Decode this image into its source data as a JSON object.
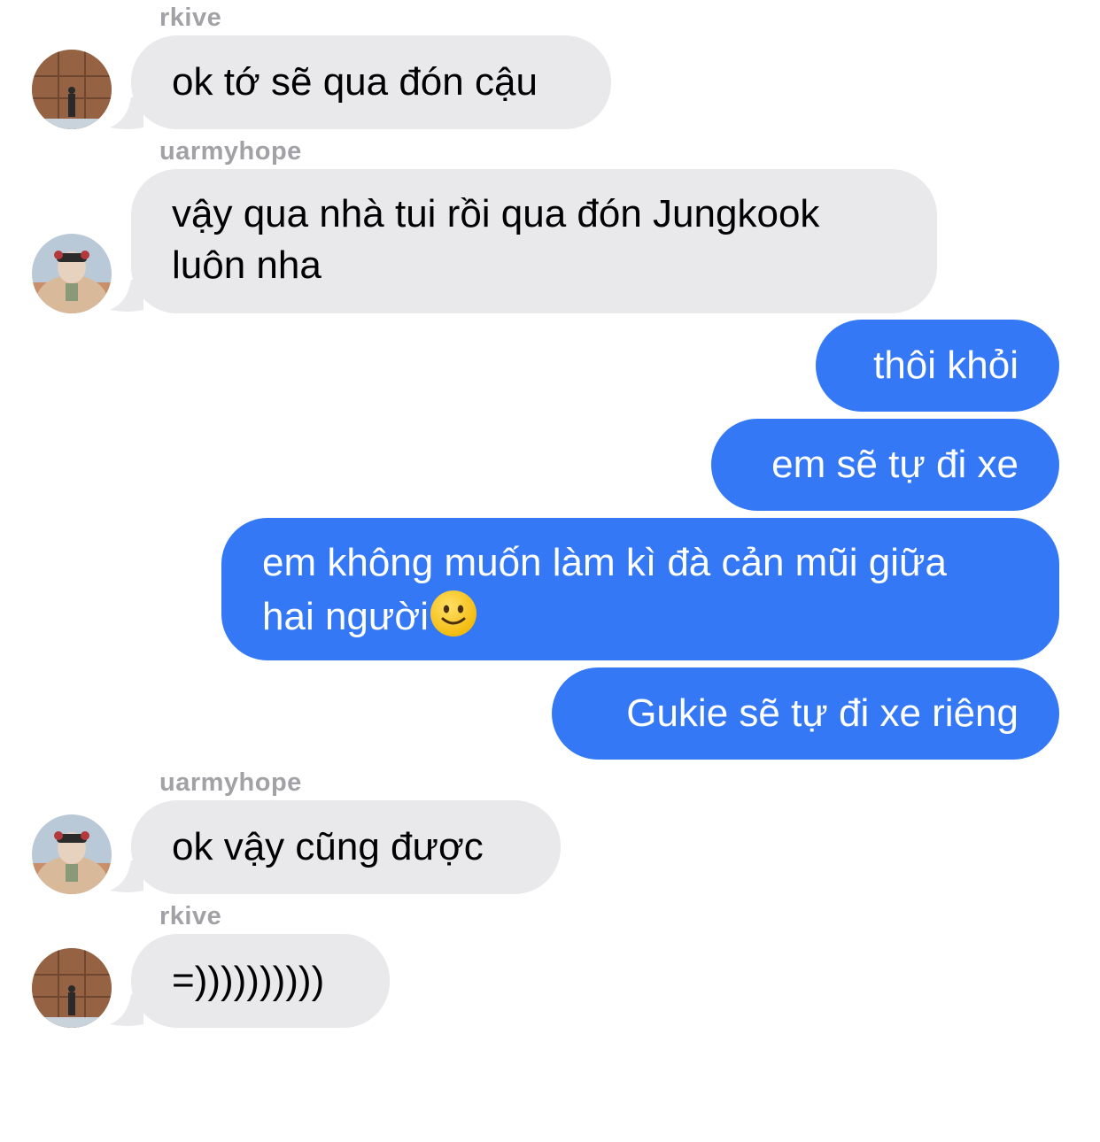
{
  "messages": [
    {
      "sender": "rkive",
      "text": "ok tớ sẽ qua đón cậu"
    },
    {
      "sender": "uarmyhope",
      "lines": [
        "vậy qua nhà tui rồi qua đón Jungkook",
        "luôn nha"
      ]
    },
    {
      "text": "thôi khỏi"
    },
    {
      "text": "em sẽ tự đi xe"
    },
    {
      "lines": [
        "em không muốn làm kì đà cản mũi giữa",
        "hai người"
      ],
      "emoji": "slightly-smiling-face-icon"
    },
    {
      "text": "Gukie sẽ tự đi xe riêng"
    },
    {
      "sender": "uarmyhope",
      "text": "ok vậy cũng được"
    },
    {
      "sender": "rkive",
      "text": "=))))))))))"
    }
  ],
  "colors": {
    "incoming_bubble": "#e9e9eb",
    "outgoing_bubble": "#3478f6",
    "sender_label": "#a1a1a6"
  }
}
